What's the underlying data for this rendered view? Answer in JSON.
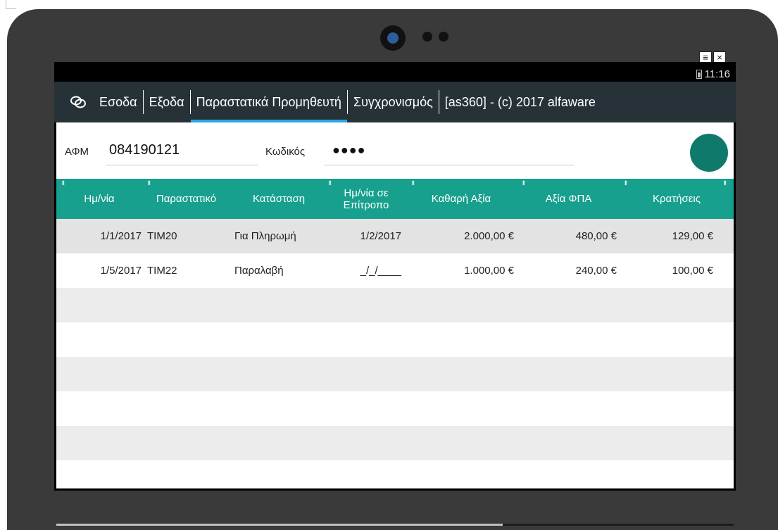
{
  "status": {
    "time": "11:16"
  },
  "window_controls": {
    "menu": "≡",
    "close": "×"
  },
  "tabs": [
    {
      "label": "Εσοδα"
    },
    {
      "label": "Εξοδα"
    },
    {
      "label": "Παραστατικά Προμηθευτή",
      "active": true
    },
    {
      "label": "Συγχρονισμός"
    },
    {
      "label": "[as360] - (c) 2017 alfaware"
    }
  ],
  "form": {
    "afm_label": "ΑΦΜ",
    "afm_value": "084190121",
    "code_label": "Κωδικός",
    "code_value": "●●●●"
  },
  "table": {
    "columns": [
      "Ημ/νία",
      "Παραστατικό",
      "Κατάσταση",
      "Ημ/νία σε Επίτροπο",
      "Καθαρή Αξία",
      "Αξία ΦΠΑ",
      "Κρατήσεις"
    ],
    "rows": [
      [
        "1/1/2017",
        "TIM20",
        "Για Πληρωμή",
        "1/2/2017",
        "2.000,00 €",
        "480,00 €",
        "129,00 €"
      ],
      [
        "1/5/2017",
        "TIM22",
        "Παραλαβή",
        "_/_/____",
        "1.000,00 €",
        "240,00 €",
        "100,00 €"
      ]
    ],
    "empty_rows": 5
  },
  "colors": {
    "tabbar": "#263238",
    "tab_indicator": "#29a8e0",
    "header": "#17a08d",
    "round_button": "#0f7a6b",
    "row_alt": "#ececec"
  },
  "icons": {
    "app": "link-rings-icon",
    "sort": "sort-arrows-icon",
    "battery": "battery-icon"
  }
}
